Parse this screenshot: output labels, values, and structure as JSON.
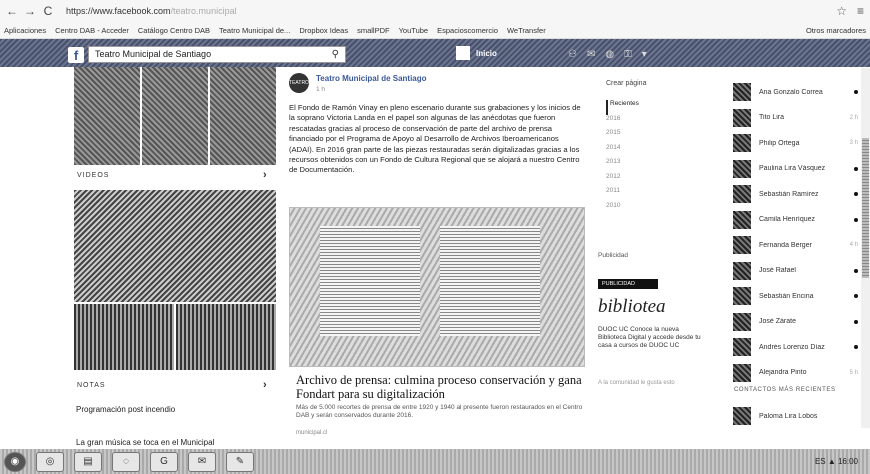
{
  "browser": {
    "url_host": "https://www.facebook.com",
    "url_rest": "/teatro.municipal",
    "back_icon": "back-arrow-icon",
    "forward_icon": "forward-arrow-icon",
    "reload_icon": "reload-icon"
  },
  "bookmarks": {
    "items": [
      "Aplicaciones",
      "Centro DAB - Acceder",
      "Catálogo Centro DAB",
      "Teatro Municipal de...",
      "Dropbox Ideas",
      "smallPDF",
      "YouTube",
      "Espacioscomercio",
      "WeTransfer"
    ],
    "other": "Otros marcadores"
  },
  "facebook": {
    "search_value": "Teatro Municipal de Santiago",
    "user_label": "Inicio",
    "brand_color": "#3b5998"
  },
  "left": {
    "videos_label": "VIDEOS",
    "notes_label": "NOTAS",
    "note_title": "Programación post incendio",
    "note_meta": "",
    "footer_text": "La gran música se toca en el Municipal"
  },
  "post": {
    "page_name": "Teatro Municipal de Santiago",
    "avatar_text": "TEATRO",
    "time": "1 h",
    "body": "El Fondo de Ramón Vinay en pleno escenario durante sus grabaciones y los inicios de la soprano Victoria Landa en el papel son algunas de las anécdotas que fueron rescatadas gracias al proceso de conservación de parte del archivo de prensa financiado por el Programa de Apoyo al Desarrollo de Archivos Iberoamericanos (ADAI). En 2016 gran parte de las piezas restauradas serán digitalizadas gracias a los recursos obtenidos con un Fondo de Cultura Regional que se alojará a nuestro Centro de Documentación.",
    "link_title": "Archivo de prensa: culmina proceso conservación y gana Fondart para su digitalización",
    "link_desc": "Más de 5.000 recortes de prensa de entre 1920 y 1940 al presente fueron restaurados en el Centro DAB y serán conservados durante 2016.",
    "link_domain": "municipal.cl"
  },
  "middle": {
    "header": "Crear página",
    "years": [
      "Recientes",
      "2016",
      "2015",
      "2014",
      "2013",
      "2012",
      "2011",
      "2010"
    ],
    "pub_label": "Publicidad",
    "ad_banner": "PUBLICIDAD",
    "ad_logo": "bibliotea",
    "ad_text": "DUOC UC Conoce la nueva Biblioteca Digital y accede desde tu casa a cursos de DUOC UC",
    "ad_small": "A la comunidad le gusta esto"
  },
  "chat": {
    "contacts": [
      {
        "name": "Ana Gonzalo Correa",
        "time": ""
      },
      {
        "name": "Tito Lira",
        "time": "2 h"
      },
      {
        "name": "Philip Ortega",
        "time": "3 h"
      },
      {
        "name": "Paulina Lira Vásquez",
        "time": ""
      },
      {
        "name": "Sebastián Ramírez",
        "time": ""
      },
      {
        "name": "Camila Henríquez",
        "time": ""
      },
      {
        "name": "Fernanda Berger",
        "time": "4 h"
      },
      {
        "name": "José Rafael",
        "time": ""
      },
      {
        "name": "Sebastián Encina",
        "time": ""
      },
      {
        "name": "José Zárate",
        "time": ""
      },
      {
        "name": "Andrés Lorenzo Díaz",
        "time": ""
      },
      {
        "name": "Alejandra Pinto",
        "time": "5 h"
      }
    ],
    "section_label": "CONTACTOS MÁS RECIENTES",
    "recent_name": "Paloma Lira Lobos"
  },
  "taskbar": {
    "buttons": [
      "◉",
      "◎",
      "▤",
      "◌",
      "G",
      "✉",
      "✎"
    ],
    "tray": "ES ▲ 16:00"
  }
}
